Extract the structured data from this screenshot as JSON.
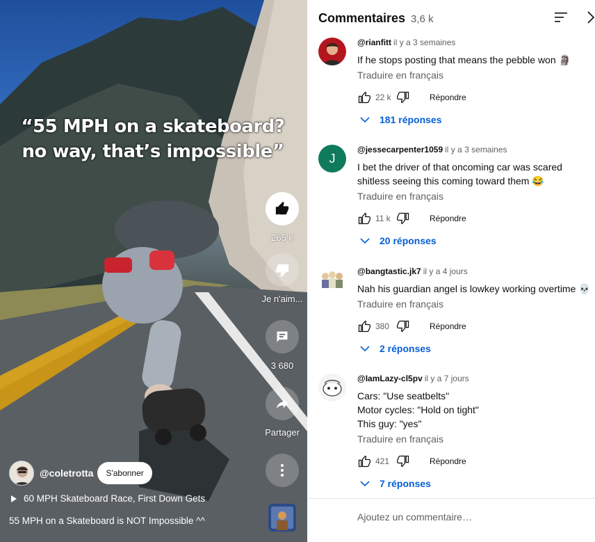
{
  "video": {
    "caption_line1": "“55 MPH on a skateboard?",
    "caption_line2": "no way, that’s impossible”",
    "likes": "265 k",
    "dislike_label": "Je n'aim...",
    "comments_count": "3 680",
    "share_label": "Partager",
    "channel_name": "@coletrotta",
    "subscribe_label": "S'abonner",
    "playlist_label": "60 MPH Skateboard Race, First Down Gets",
    "title": "55 MPH on a Skateboard is NOT Impossible ^^"
  },
  "comments_panel": {
    "title": "Commentaires",
    "count": "3,6 k",
    "add_placeholder": "Ajoutez un commentaire…",
    "translate_label": "Traduire en français",
    "reply_label": "Répondre",
    "items": [
      {
        "author": "@rianfitt",
        "time": "il y a 3 semaines",
        "text": "If he stops posting that means the pebble won 🗿",
        "likes": "22 k",
        "replies": "181 réponses"
      },
      {
        "author": "@jessecarpenter1059",
        "time": "il y a 3 semaines",
        "text": "I bet the driver of that oncoming car was scared shitless seeing this coming toward them 😂",
        "likes": "11 k",
        "replies": "20 réponses",
        "avatar_letter": "J"
      },
      {
        "author": "@bangtastic.jk7",
        "time": "il y a 4 jours",
        "text": "Nah his guardian angel is lowkey working overtime 💀",
        "likes": "380",
        "replies": "2 réponses"
      },
      {
        "author": "@IamLazy-cl5pv",
        "time": "il y a 7 jours",
        "text_lines": [
          "Cars: \"Use seatbelts\"",
          "Motor cycles: \"Hold on tight\"",
          "This guy: \"yes\""
        ],
        "likes": "421",
        "replies": "7 réponses"
      }
    ]
  },
  "colors": {
    "link_blue": "#065fd4",
    "avatar_green": "#0f7a5c",
    "text_primary": "#0f0f0f",
    "text_secondary": "#606060"
  }
}
